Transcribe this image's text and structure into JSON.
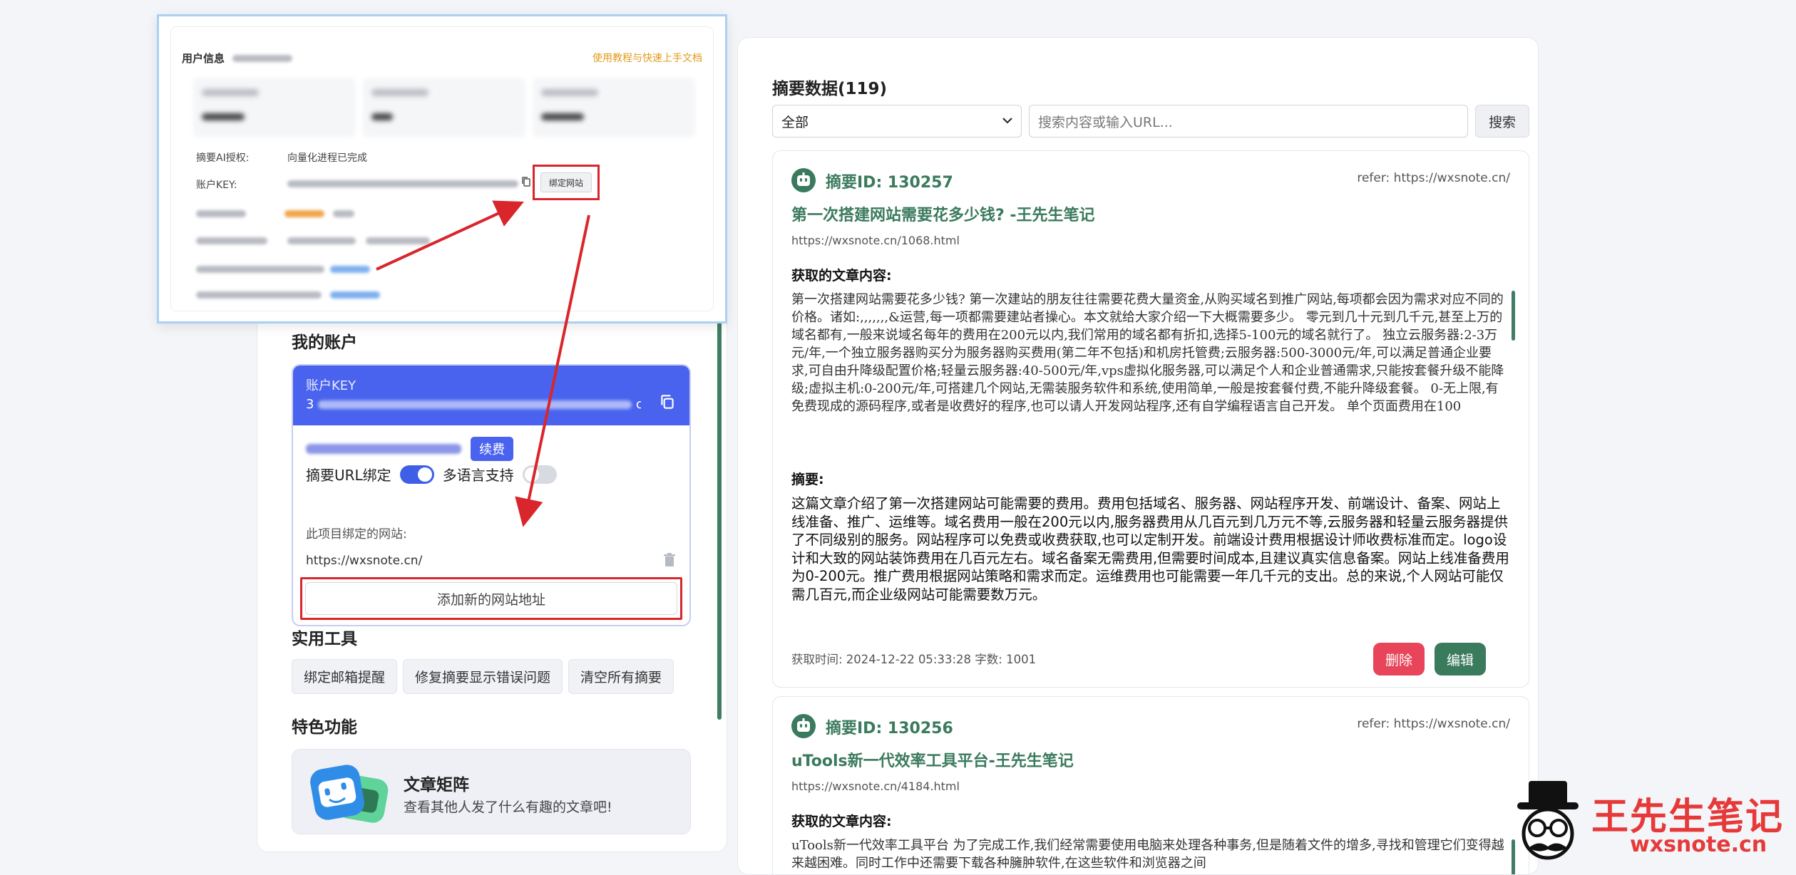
{
  "left": {
    "account_title": "我的账户",
    "key_label": "账户KEY",
    "key_prefix": "3",
    "key_suffix": "c",
    "renew_label": "续费",
    "toggle_url_bind": "摘要URL绑定",
    "toggle_url_bind_on": true,
    "toggle_multilang": "多语言支持",
    "toggle_multilang_on": false,
    "bound_sites_label": "此项目绑定的网站:",
    "bound_site_url": "https://wxsnote.cn/",
    "add_site_label": "添加新的网站地址",
    "tools_title": "实用工具",
    "tools": [
      "绑定邮箱提醒",
      "修复摘要显示错误问题",
      "清空所有摘要"
    ],
    "features_title": "特色功能",
    "feature_name": "文章矩阵",
    "feature_desc": "查看其他人发了什么有趣的文章吧!"
  },
  "popup": {
    "user_info_label": "用户信息",
    "guide_link": "使用教程与快速上手文档",
    "ai_auth_label": "摘要AI授权:",
    "ai_auth_value": "向量化进程已完成",
    "account_key_label": "账户KEY:",
    "bind_site_button": "绑定网站"
  },
  "summary": {
    "title": "摘要数据(119)",
    "filter_selected": "全部",
    "search_placeholder": "搜索内容或输入URL...",
    "search_button": "搜索",
    "content_label": "获取的文章内容:",
    "summary_label": "摘要:",
    "delete_button": "删除",
    "edit_button": "编辑",
    "cards": [
      {
        "id": "摘要ID: 130257",
        "refer": "refer: https://wxsnote.cn/",
        "title": "第一次搭建网站需要花多少钱? -王先生笔记",
        "url": "https://wxsnote.cn/1068.html",
        "content": "第一次搭建网站需要花多少钱? 第一次建站的朋友往往需要花费大量资金,从购买域名到推广网站,每项都会因为需求对应不同的价格。诸如:,,,,,,,&运营,每一项都需要建站者操心。本文就给大家介绍一下大概需要多少。 零元到几十元到几千元,甚至上万的域名都有,一般来说域名每年的费用在200元以内,我们常用的域名都有折扣,选择5-100元的域名就行了。 独立云服务器:2-3万元/年,一个独立服务器购买分为服务器购买费用(第二年不包括)和机房托管费;云服务器:500-3000元/年,可以满足普通企业要求,可自由升降级配置价格;轻量云服务器:40-500元/年,vps虚拟化服务器,可以满足个人和企业普通需求,只能按套餐升级不能降级;虚拟主机:0-200元/年,可搭建几个网站,无需装服务软件和系统,使用简单,一般是按套餐付费,不能升降级套餐。 0-无上限,有免费现成的源码程序,或者是收费好的程序,也可以请人开发网站程序,还有自学编程语言自己开发。 单个页面费用在100",
        "summary": "这篇文章介绍了第一次搭建网站可能需要的费用。费用包括域名、服务器、网站程序开发、前端设计、备案、网站上线准备、推广、运维等。域名费用一般在200元以内,服务器费用从几百元到几万元不等,云服务器和轻量云服务器提供了不同级别的服务。网站程序可以免费或收费获取,也可以定制开发。前端设计费用根据设计师收费标准而定。logo设计和大致的网站装饰费用在几百元左右。域名备案无需费用,但需要时间成本,且建议真实信息备案。网站上线准备费用为0-200元。推广费用根据网站策略和需求而定。运维费用也可能需要一年几千元的支出。总的来说,个人网站可能仅需几百元,而企业级网站可能需要数万元。",
        "meta": "获取时间: 2024-12-22 05:33:28 字数: 1001"
      },
      {
        "id": "摘要ID: 130256",
        "refer": "refer: https://wxsnote.cn/",
        "title": "uTools新一代效率工具平台-王先生笔记",
        "url": "https://wxsnote.cn/4184.html",
        "content": "uTools新一代效率工具平台 为了完成工作,我们经常需要使用电脑来处理各种事务,但是随着文件的增多,寻找和管理它们变得越来越困难。同时工作中还需要下载各种臃肿软件,在这些软件和浏览器之间"
      }
    ]
  },
  "watermark": {
    "name": "王先生笔记",
    "url": "wxsnote.cn"
  },
  "colors": {
    "accent_green": "#3a7a5d",
    "account_blue": "#4a63ee",
    "highlight_red": "#d9262c",
    "delete_red": "#e8445a",
    "guide_orange": "#e09b1a"
  }
}
